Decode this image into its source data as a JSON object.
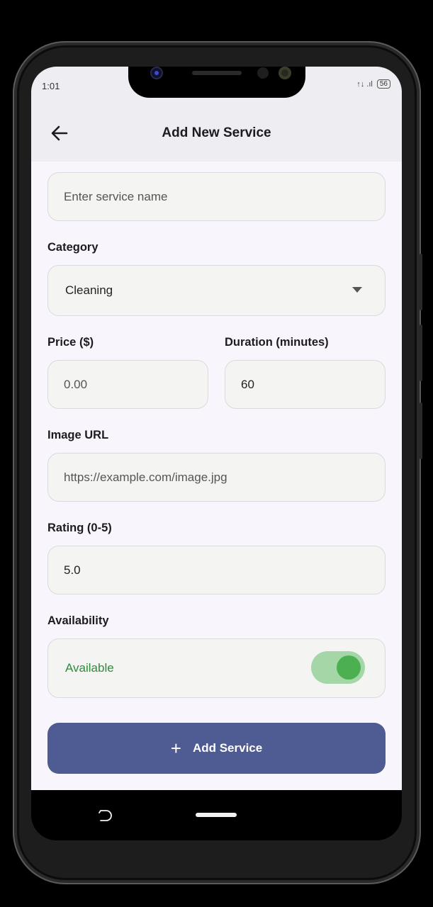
{
  "status_bar": {
    "time": "1:01",
    "signal": "↑↓ .ıl",
    "battery": "56"
  },
  "app_bar": {
    "title": "Add New Service"
  },
  "form": {
    "service_name_placeholder": "Enter service name",
    "category": {
      "label": "Category",
      "value": "Cleaning"
    },
    "price": {
      "label": "Price ($)",
      "placeholder": "0.00"
    },
    "duration": {
      "label": "Duration (minutes)",
      "value": "60"
    },
    "image_url": {
      "label": "Image URL",
      "placeholder": "https://example.com/image.jpg"
    },
    "rating": {
      "label": "Rating (0-5)",
      "value": "5.0"
    },
    "availability": {
      "label": "Availability",
      "status": "Available",
      "enabled": true
    }
  },
  "submit": {
    "icon": "+",
    "label": "Add Service"
  },
  "colors": {
    "accent": "#4f5b93",
    "available": "#2e8b3a",
    "switch_on": "#4caf50"
  }
}
